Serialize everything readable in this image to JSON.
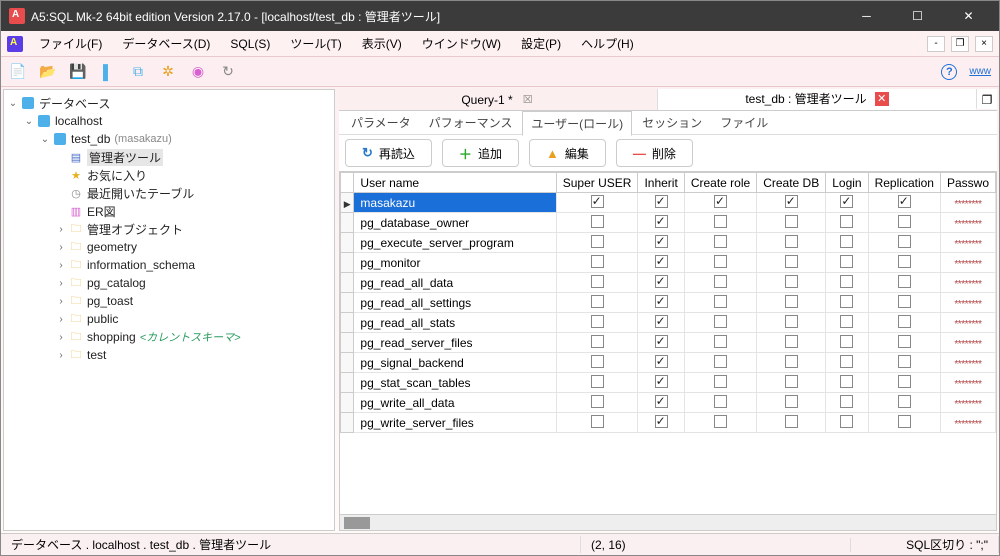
{
  "window": {
    "title": "A5:SQL Mk-2 64bit edition Version 2.17.0 - [localhost/test_db : 管理者ツール]"
  },
  "menu": {
    "file": "ファイル(F)",
    "database": "データベース(D)",
    "sql": "SQL(S)",
    "tool": "ツール(T)",
    "view": "表示(V)",
    "window": "ウインドウ(W)",
    "settings": "設定(P)",
    "help": "ヘルプ(H)",
    "www": "www"
  },
  "sidebar": {
    "root": "データベース",
    "host": "localhost",
    "db": "test_db",
    "db_hint": "(masakazu)",
    "admin_tool": "管理者ツール",
    "favorites": "お気に入り",
    "recent_tables": "最近開いたテーブル",
    "er": "ER図",
    "mgmt_obj": "管理オブジェクト",
    "schemas": [
      "geometry",
      "information_schema",
      "pg_catalog",
      "pg_toast",
      "public",
      "shopping",
      "test"
    ],
    "current_schema_hint": "<カレントスキーマ>"
  },
  "doctabs": {
    "query": "Query-1 *",
    "admin": "test_db : 管理者ツール"
  },
  "subtabs": {
    "params": "パラメータ",
    "perf": "パフォーマンス",
    "users": "ユーザー(ロール)",
    "session": "セッション",
    "file": "ファイル"
  },
  "buttons": {
    "reload": "再読込",
    "add": "追加",
    "edit": "編集",
    "delete": "削除"
  },
  "grid": {
    "columns": [
      "User name",
      "Super USER",
      "Inherit",
      "Create role",
      "Create DB",
      "Login",
      "Replication",
      "Passwo"
    ],
    "rows": [
      {
        "name": "masakazu",
        "flags": [
          true,
          true,
          true,
          true,
          true,
          true
        ],
        "sel": true
      },
      {
        "name": "pg_database_owner",
        "flags": [
          false,
          true,
          false,
          false,
          false,
          false
        ]
      },
      {
        "name": "pg_execute_server_program",
        "flags": [
          false,
          true,
          false,
          false,
          false,
          false
        ]
      },
      {
        "name": "pg_monitor",
        "flags": [
          false,
          true,
          false,
          false,
          false,
          false
        ]
      },
      {
        "name": "pg_read_all_data",
        "flags": [
          false,
          true,
          false,
          false,
          false,
          false
        ]
      },
      {
        "name": "pg_read_all_settings",
        "flags": [
          false,
          true,
          false,
          false,
          false,
          false
        ]
      },
      {
        "name": "pg_read_all_stats",
        "flags": [
          false,
          true,
          false,
          false,
          false,
          false
        ]
      },
      {
        "name": "pg_read_server_files",
        "flags": [
          false,
          true,
          false,
          false,
          false,
          false
        ]
      },
      {
        "name": "pg_signal_backend",
        "flags": [
          false,
          true,
          false,
          false,
          false,
          false
        ]
      },
      {
        "name": "pg_stat_scan_tables",
        "flags": [
          false,
          true,
          false,
          false,
          false,
          false
        ]
      },
      {
        "name": "pg_write_all_data",
        "flags": [
          false,
          true,
          false,
          false,
          false,
          false
        ]
      },
      {
        "name": "pg_write_server_files",
        "flags": [
          false,
          true,
          false,
          false,
          false,
          false
        ]
      }
    ],
    "password_mask": "********"
  },
  "status": {
    "path": "データベース . localhost . test_db . 管理者ツール",
    "pos": "(2, 16)",
    "sep": "SQL区切り : \";\""
  }
}
